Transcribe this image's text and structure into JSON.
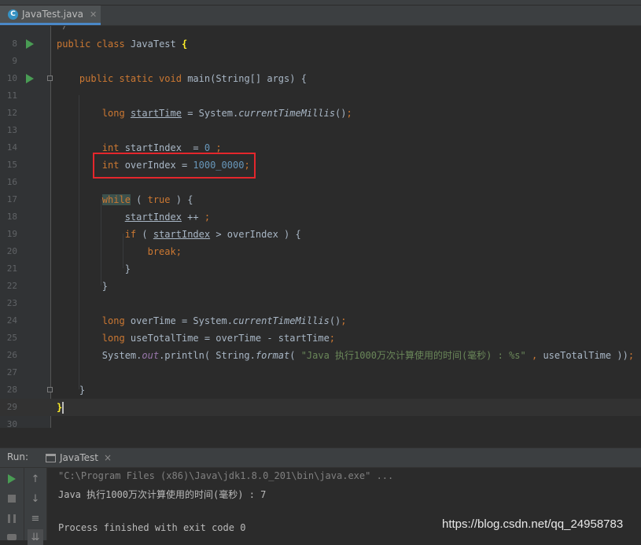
{
  "tab": {
    "filename": "JavaTest.java",
    "icon": "C",
    "close": "✕"
  },
  "editor": {
    "lines": [
      {
        "num": "8",
        "parts": [
          [
            "k",
            "public"
          ],
          [
            "id",
            " "
          ],
          [
            "k",
            "class"
          ],
          [
            "id",
            " JavaTest "
          ],
          [
            "brace-hl",
            "{"
          ]
        ]
      },
      {
        "num": "9",
        "parts": []
      },
      {
        "num": "10",
        "parts": [
          [
            "id",
            "    "
          ],
          [
            "k",
            "public static void"
          ],
          [
            "id",
            " "
          ],
          [
            "m",
            "main"
          ],
          [
            "id",
            "(String[] args) {"
          ]
        ]
      },
      {
        "num": "11",
        "parts": []
      },
      {
        "num": "12",
        "parts": [
          [
            "id",
            "        "
          ],
          [
            "k",
            "long"
          ],
          [
            "id",
            " "
          ],
          [
            "ulfld",
            "startTime"
          ],
          [
            "id",
            " = System."
          ],
          [
            "it",
            "currentTimeMillis"
          ],
          [
            "id",
            "()"
          ],
          [
            "k",
            ";"
          ]
        ]
      },
      {
        "num": "13",
        "parts": []
      },
      {
        "num": "14",
        "parts": [
          [
            "id",
            "        "
          ],
          [
            "k",
            "int"
          ],
          [
            "id",
            " startIndex  = "
          ],
          [
            "num",
            "0"
          ],
          [
            "id",
            " "
          ],
          [
            "k",
            ";"
          ]
        ]
      },
      {
        "num": "15",
        "parts": [
          [
            "id",
            "        "
          ],
          [
            "k",
            "int"
          ],
          [
            "id",
            " overIndex = "
          ],
          [
            "num",
            "1000_0000"
          ],
          [
            "k",
            ";"
          ]
        ]
      },
      {
        "num": "16",
        "parts": []
      },
      {
        "num": "17",
        "parts": [
          [
            "id",
            "        "
          ],
          [
            "while",
            "while"
          ],
          [
            "id",
            " ( "
          ],
          [
            "k",
            "true"
          ],
          [
            "id",
            " ) {"
          ]
        ]
      },
      {
        "num": "18",
        "parts": [
          [
            "id",
            "            "
          ],
          [
            "ul",
            "startIndex"
          ],
          [
            "id",
            " ++ "
          ],
          [
            "k",
            ";"
          ]
        ]
      },
      {
        "num": "19",
        "parts": [
          [
            "id",
            "            "
          ],
          [
            "k",
            "if"
          ],
          [
            "id",
            " ( "
          ],
          [
            "ul",
            "startIndex"
          ],
          [
            "id",
            " > overIndex ) {"
          ]
        ]
      },
      {
        "num": "20",
        "parts": [
          [
            "id",
            "                "
          ],
          [
            "k",
            "break"
          ],
          [
            "k",
            ";"
          ]
        ]
      },
      {
        "num": "21",
        "parts": [
          [
            "id",
            "            }"
          ]
        ]
      },
      {
        "num": "22",
        "parts": [
          [
            "id",
            "        }"
          ]
        ]
      },
      {
        "num": "23",
        "parts": []
      },
      {
        "num": "24",
        "parts": [
          [
            "id",
            "        "
          ],
          [
            "k",
            "long"
          ],
          [
            "id",
            " overTime = System."
          ],
          [
            "it",
            "currentTimeMillis"
          ],
          [
            "id",
            "()"
          ],
          [
            "k",
            ";"
          ]
        ]
      },
      {
        "num": "25",
        "parts": [
          [
            "id",
            "        "
          ],
          [
            "k",
            "long"
          ],
          [
            "id",
            " useTotalTime = overTime - startTime"
          ],
          [
            "k",
            ";"
          ]
        ]
      },
      {
        "num": "26",
        "parts": [
          [
            "id",
            "        System."
          ],
          [
            "fld",
            "out"
          ],
          [
            "id",
            ".println( String."
          ],
          [
            "it",
            "format"
          ],
          [
            "id",
            "( "
          ],
          [
            "str",
            "\"Java 执行1000万次计算使用的时间(毫秒) : %s\""
          ],
          [
            "k",
            " , "
          ],
          [
            "id",
            "useTotalTime ))"
          ],
          [
            "k",
            ";"
          ]
        ]
      },
      {
        "num": "27",
        "parts": []
      },
      {
        "num": "28",
        "parts": [
          [
            "id",
            "    }"
          ]
        ]
      },
      {
        "num": "29",
        "parts": [
          [
            "brace-hl",
            "}"
          ]
        ]
      },
      {
        "num": "30",
        "parts": []
      }
    ],
    "partial_top_comment": "*/"
  },
  "run": {
    "label": "Run:",
    "tab_name": "JavaTest",
    "tab_close": "×",
    "console_lines": [
      "\"C:\\Program Files (x86)\\Java\\jdk1.8.0_201\\bin\\java.exe\" ...",
      "Java 执行1000万次计算使用的时间(毫秒) : 7",
      "",
      "Process finished with exit code 0"
    ]
  },
  "watermark": "https://blog.csdn.net/qq_24958783",
  "colors": {
    "keyword": "#cc7832",
    "number": "#6897bb",
    "string": "#6a8759",
    "field": "#9876aa",
    "highlight_box": "#e4262c",
    "run_green": "#499c54"
  }
}
